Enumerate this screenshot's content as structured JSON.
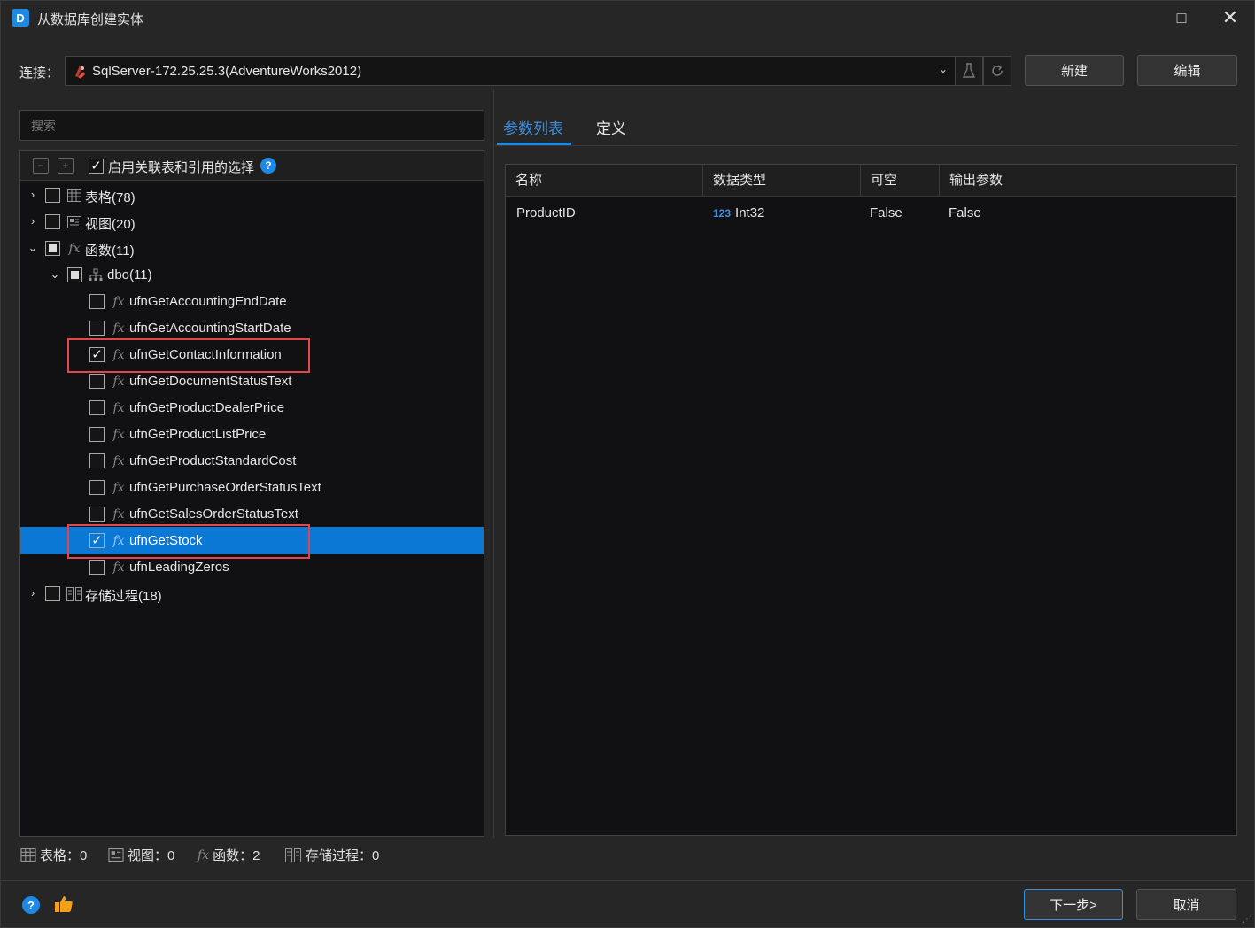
{
  "window": {
    "title": "从数据库创建实体",
    "logo": "D",
    "maximize_icon": "□",
    "close_icon": "✕"
  },
  "connection": {
    "label": "连接：",
    "value": "SqlServer-172.25.25.3(AdventureWorks2012)",
    "new_button": "新建",
    "edit_button": "编辑"
  },
  "search": {
    "placeholder": "搜索"
  },
  "tree_toolbar": {
    "cascade_label": "启用关联表和引用的选择",
    "cascade_checked": true
  },
  "tree": {
    "tables": {
      "label": "表格(78)",
      "checked": false
    },
    "views": {
      "label": "视图(20)",
      "checked": false
    },
    "functions": {
      "label": "函数(11)",
      "checked": "partial"
    },
    "dbo": {
      "label": "dbo(11)",
      "checked": "partial"
    },
    "function_items": [
      {
        "label": "ufnGetAccountingEndDate",
        "checked": false
      },
      {
        "label": "ufnGetAccountingStartDate",
        "checked": false
      },
      {
        "label": "ufnGetContactInformation",
        "checked": true
      },
      {
        "label": "ufnGetDocumentStatusText",
        "checked": false
      },
      {
        "label": "ufnGetProductDealerPrice",
        "checked": false
      },
      {
        "label": "ufnGetProductListPrice",
        "checked": false
      },
      {
        "label": "ufnGetProductStandardCost",
        "checked": false
      },
      {
        "label": "ufnGetPurchaseOrderStatusText",
        "checked": false
      },
      {
        "label": "ufnGetSalesOrderStatusText",
        "checked": false
      },
      {
        "label": "ufnGetStock",
        "checked": true,
        "selected": true
      },
      {
        "label": "ufnLeadingZeros",
        "checked": false
      }
    ],
    "procedures": {
      "label": "存储过程(18)",
      "checked": false
    }
  },
  "tabs": {
    "params": "参数列表",
    "definition": "定义",
    "active": "params"
  },
  "param_grid": {
    "columns": [
      "名称",
      "数据类型",
      "可空",
      "输出参数"
    ],
    "rows": [
      {
        "name": "ProductID",
        "type_badge": "123",
        "type": "Int32",
        "nullable": "False",
        "output": "False"
      }
    ]
  },
  "stats": {
    "tables": "表格：0",
    "views": "视图：0",
    "functions": "函数：2",
    "procedures": "存储过程：0"
  },
  "footer": {
    "next_button": "下一步>",
    "cancel_button": "取消"
  },
  "colors": {
    "accent": "#1e88e5",
    "selection": "#0a78d4",
    "highlight_box": "#e0484a",
    "thumb": "#f3a11b"
  }
}
